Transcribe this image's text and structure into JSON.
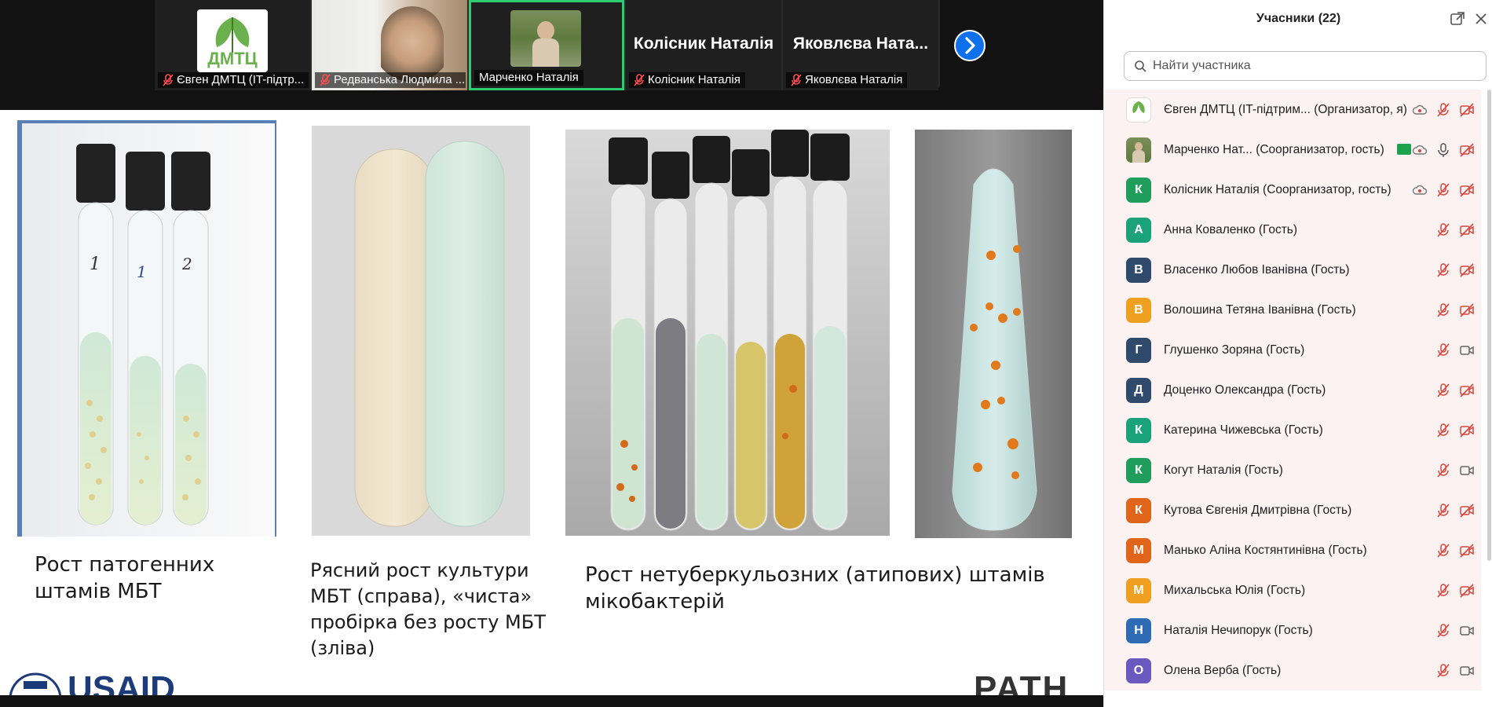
{
  "video_strip": {
    "tiles": [
      {
        "label": "Євген ДМТЦ (IT-підтр...",
        "logo_text": "ДМТЦ"
      },
      {
        "label": "Редванська Людмила ..."
      },
      {
        "label": "Марченко Наталія"
      },
      {
        "label": "Колісник Наталія",
        "big_name": "Колісник Наталія"
      },
      {
        "label": "Яковлєва Наталія",
        "big_name": "Яковлєва Ната..."
      }
    ]
  },
  "slide": {
    "captions": {
      "c1_line1": "Рост патогенних",
      "c1_line2": "штамів МБТ",
      "c2_line1": "Рясний рост культури",
      "c2_line2": "МБТ (справа), «чиста»",
      "c2_line3": "пробірка без росту МБТ",
      "c2_line4": "(зліва)",
      "c3_line1": "Рост нетуберкульозних (атипових) штамів",
      "c3_line2": "мікобактерій"
    },
    "logos": {
      "left": "USAID",
      "right": "PATH"
    }
  },
  "panel": {
    "title": "Учасники (22)",
    "search_placeholder": "Найти участника",
    "participants": [
      {
        "name": "Євген ДМТЦ (IT-підтрим...  (Организатор, я)",
        "avatar": "",
        "color": "#ffffff"
      },
      {
        "name": "Марченко Нат... (Соорганизатор, гость)",
        "avatar": "",
        "color": "#7a9a5a"
      },
      {
        "name": "Колісник Наталія (Соорганизатор, гость)",
        "avatar": "К",
        "color": "#1e9e5a"
      },
      {
        "name": "Анна Коваленко (Гость)",
        "avatar": "А",
        "color": "#1aa37a"
      },
      {
        "name": "Власенко  Любов Іванівна (Гость)",
        "avatar": "В",
        "color": "#2f4a6b"
      },
      {
        "name": "Волошина Тетяна Іванівна (Гость)",
        "avatar": "В",
        "color": "#f0a020"
      },
      {
        "name": "Глушенко Зоряна (Гость)",
        "avatar": "Г",
        "color": "#2f4a6b"
      },
      {
        "name": "Доценко Олександра (Гость)",
        "avatar": "Д",
        "color": "#2f4a6b"
      },
      {
        "name": "Катерина Чижевська (Гость)",
        "avatar": "К",
        "color": "#1aa37a"
      },
      {
        "name": "Когут Наталія (Гость)",
        "avatar": "К",
        "color": "#1e9e5a"
      },
      {
        "name": "Кутова Євгенія Дмитрівна (Гость)",
        "avatar": "К",
        "color": "#e0651a"
      },
      {
        "name": "Манько Аліна Костянтинівна (Гость)",
        "avatar": "М",
        "color": "#e0651a"
      },
      {
        "name": "Михальська Юлія (Гость)",
        "avatar": "М",
        "color": "#f0a020"
      },
      {
        "name": "Наталія   Нечипорук (Гость)",
        "avatar": "Н",
        "color": "#2f6ab5"
      },
      {
        "name": "Олена Верба (Гость)",
        "avatar": "О",
        "color": "#6a5ac0"
      }
    ]
  }
}
